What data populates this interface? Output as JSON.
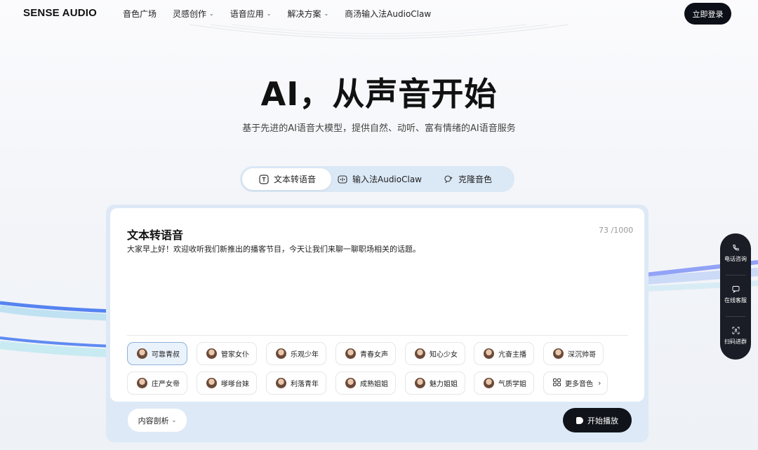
{
  "header": {
    "logo": "SENSE AUDIO",
    "nav": [
      {
        "label": "音色广场",
        "dropdown": false
      },
      {
        "label": "灵感创作",
        "dropdown": true
      },
      {
        "label": "语音应用",
        "dropdown": true
      },
      {
        "label": "解决方案",
        "dropdown": true
      },
      {
        "label": "商汤输入法AudioClaw",
        "dropdown": false
      }
    ],
    "login_label": "立即登录"
  },
  "hero": {
    "title": "AI，从声音开始",
    "subtitle": "基于先进的AI语音大模型，提供自然、动听、富有情绪的AI语音服务"
  },
  "tabs": [
    {
      "label": "文本转语音",
      "icon": "text-icon",
      "active": true
    },
    {
      "label": "输入法AudioClaw",
      "icon": "waveform-icon",
      "active": false
    },
    {
      "label": "克隆音色",
      "icon": "clone-voice-icon",
      "active": false
    }
  ],
  "editor": {
    "title": "文本转语音",
    "count": "73 /1000",
    "text": "大家早上好！欢迎收听我们新推出的播客节目，今天让我们来聊一聊职场相关的话题。"
  },
  "voices": [
    {
      "label": "可靠青叔",
      "selected": true
    },
    {
      "label": "管家女仆",
      "selected": false
    },
    {
      "label": "乐观少年",
      "selected": false
    },
    {
      "label": "青春女声",
      "selected": false
    },
    {
      "label": "知心少女",
      "selected": false
    },
    {
      "label": "亢奋主播",
      "selected": false
    },
    {
      "label": "深沉帅哥",
      "selected": false
    },
    {
      "label": "庄严女帝",
      "selected": false
    },
    {
      "label": "嗲嗲台妹",
      "selected": false
    },
    {
      "label": "利落青年",
      "selected": false
    },
    {
      "label": "成熟姐姐",
      "selected": false
    },
    {
      "label": "魅力姐姐",
      "selected": false
    },
    {
      "label": "气质学姐",
      "selected": false
    }
  ],
  "more_voices_label": "更多音色",
  "analysis_label": "内容剖析",
  "play_label": "开始播放",
  "side_panel": [
    {
      "label": "电话咨询",
      "icon": "phone-icon"
    },
    {
      "label": "在线客服",
      "icon": "chat-icon"
    },
    {
      "label": "扫码进群",
      "icon": "qr-scan-icon"
    }
  ],
  "colors": {
    "accent_dark": "#0c0f17",
    "tab_bg": "#dbe8f6",
    "selected_voice_border": "#8fb2dc",
    "wave_blue": "#3a6ff0"
  }
}
